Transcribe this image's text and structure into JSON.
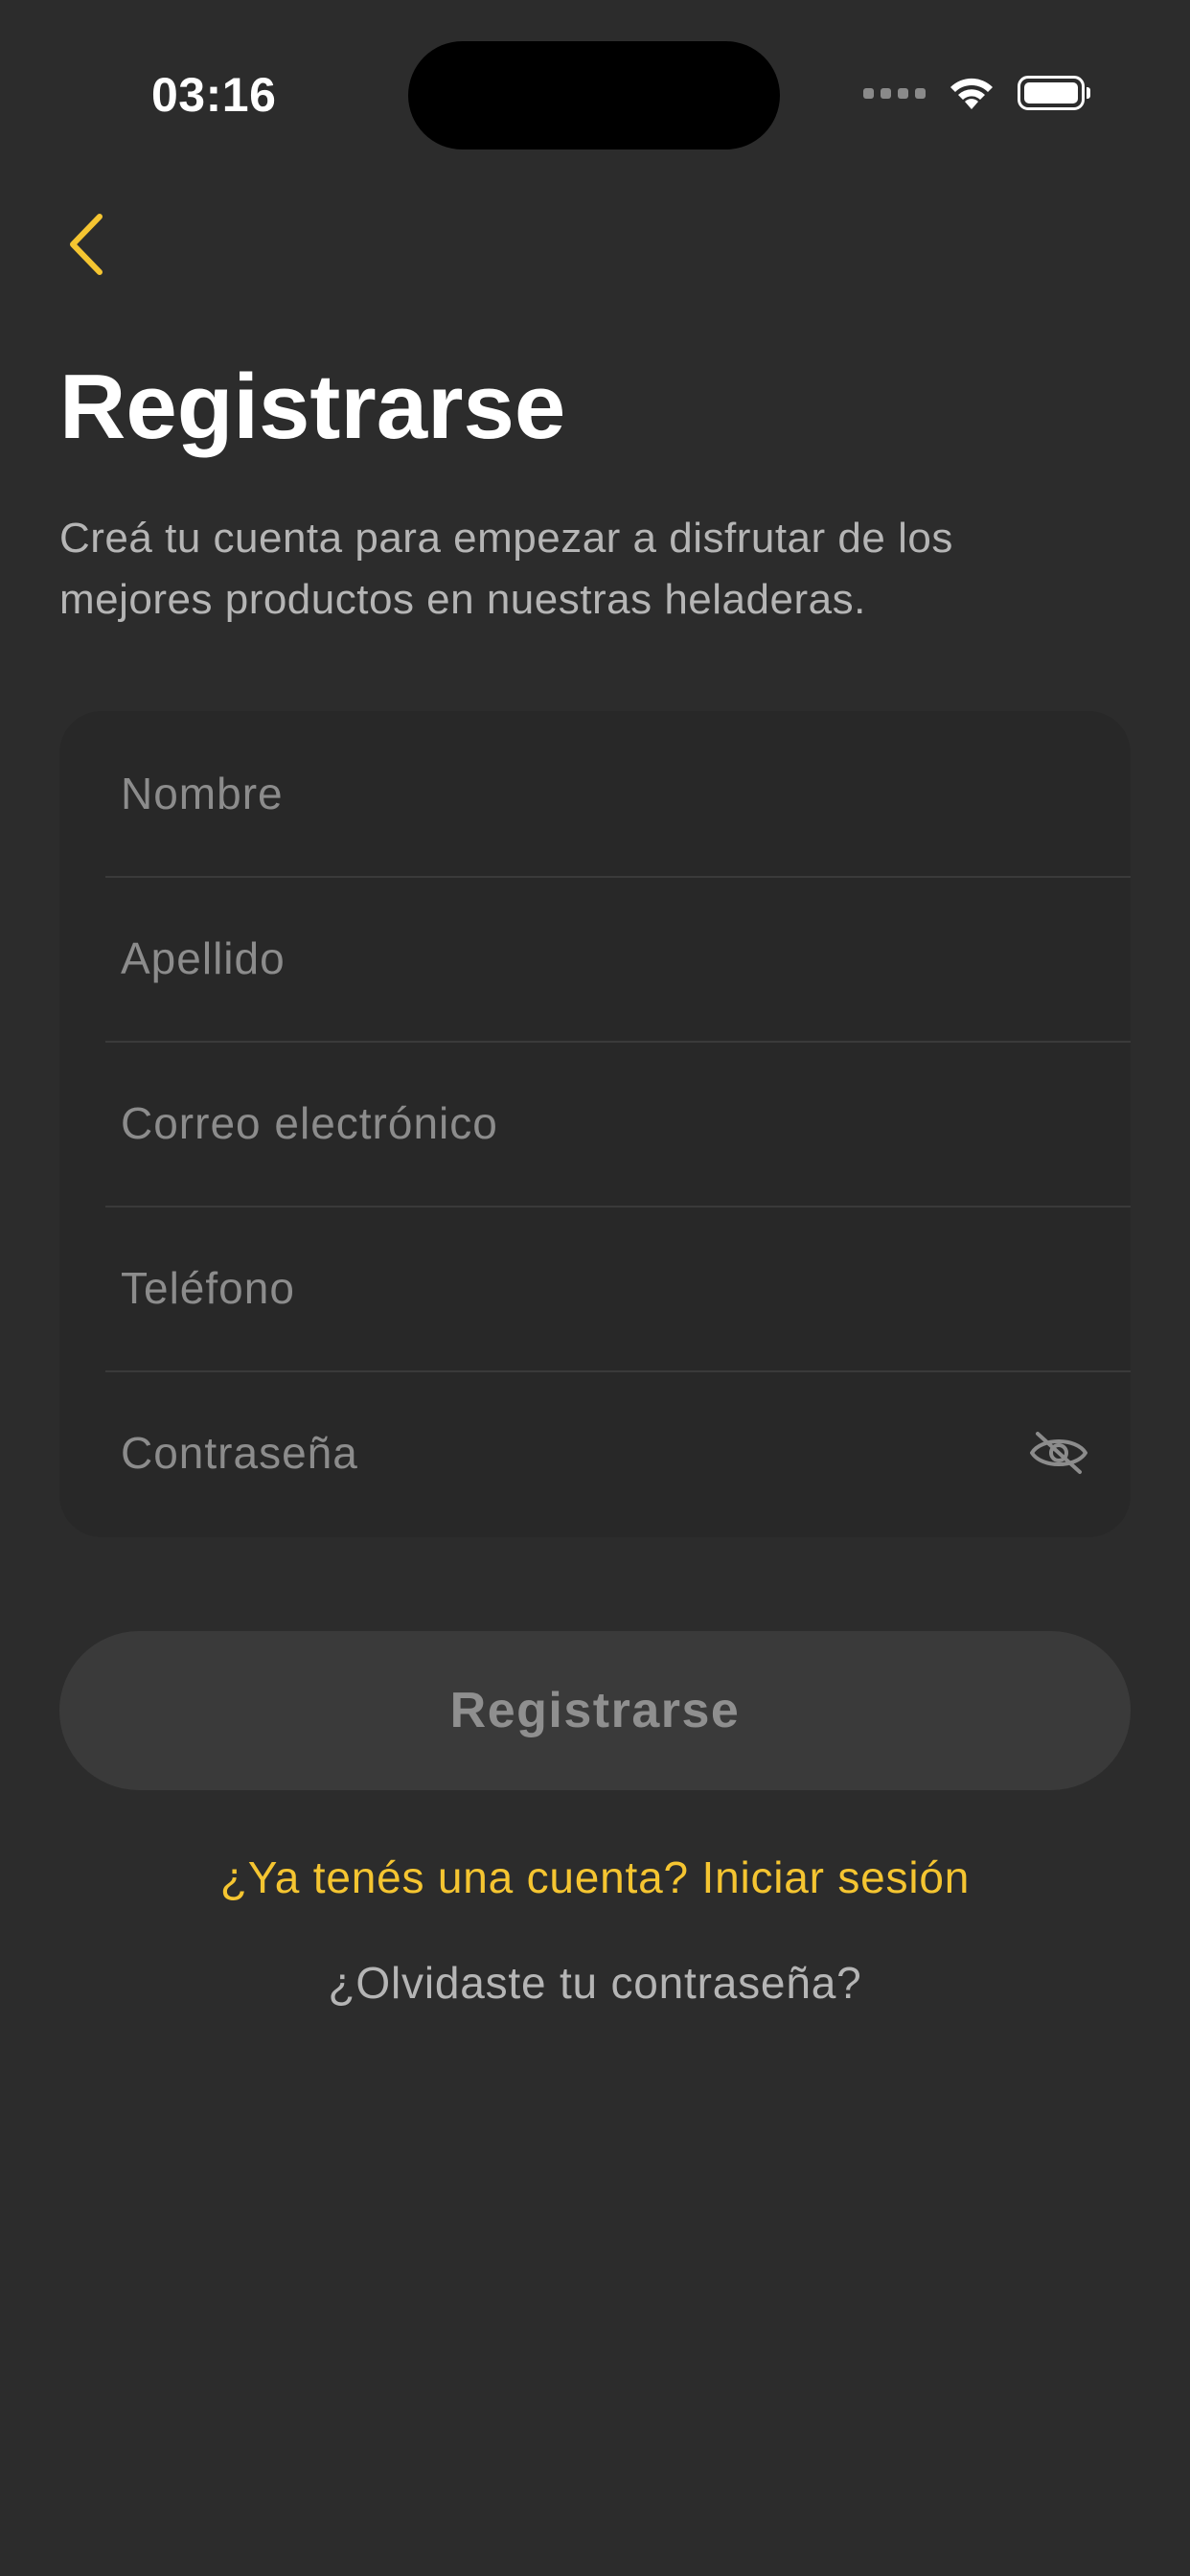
{
  "status_bar": {
    "time": "03:16"
  },
  "header": {
    "back_icon": "chevron-left-icon",
    "title": "Registrarse",
    "subtitle": "Creá tu cuenta para empezar a disfrutar de los mejores productos en nuestras heladeras."
  },
  "form": {
    "fields": [
      {
        "name": "first-name",
        "placeholder": "Nombre",
        "value": ""
      },
      {
        "name": "last-name",
        "placeholder": "Apellido",
        "value": ""
      },
      {
        "name": "email",
        "placeholder": "Correo electrónico",
        "value": ""
      },
      {
        "name": "phone",
        "placeholder": "Teléfono",
        "value": ""
      },
      {
        "name": "password",
        "placeholder": "Contraseña",
        "value": ""
      }
    ],
    "password_toggle_icon": "eye-slash-icon"
  },
  "actions": {
    "register_label": "Registrarse",
    "login_prompt": "¿Ya tenés una cuenta? Iniciar sesión",
    "forgot_password": "¿Olvidaste tu contraseña?"
  },
  "colors": {
    "background": "#2c2c2c",
    "card": "#282828",
    "accent": "#f5c531",
    "button_disabled": "#3a3a3a",
    "muted_text": "#b5b5b5",
    "placeholder": "#8c8c8c"
  }
}
